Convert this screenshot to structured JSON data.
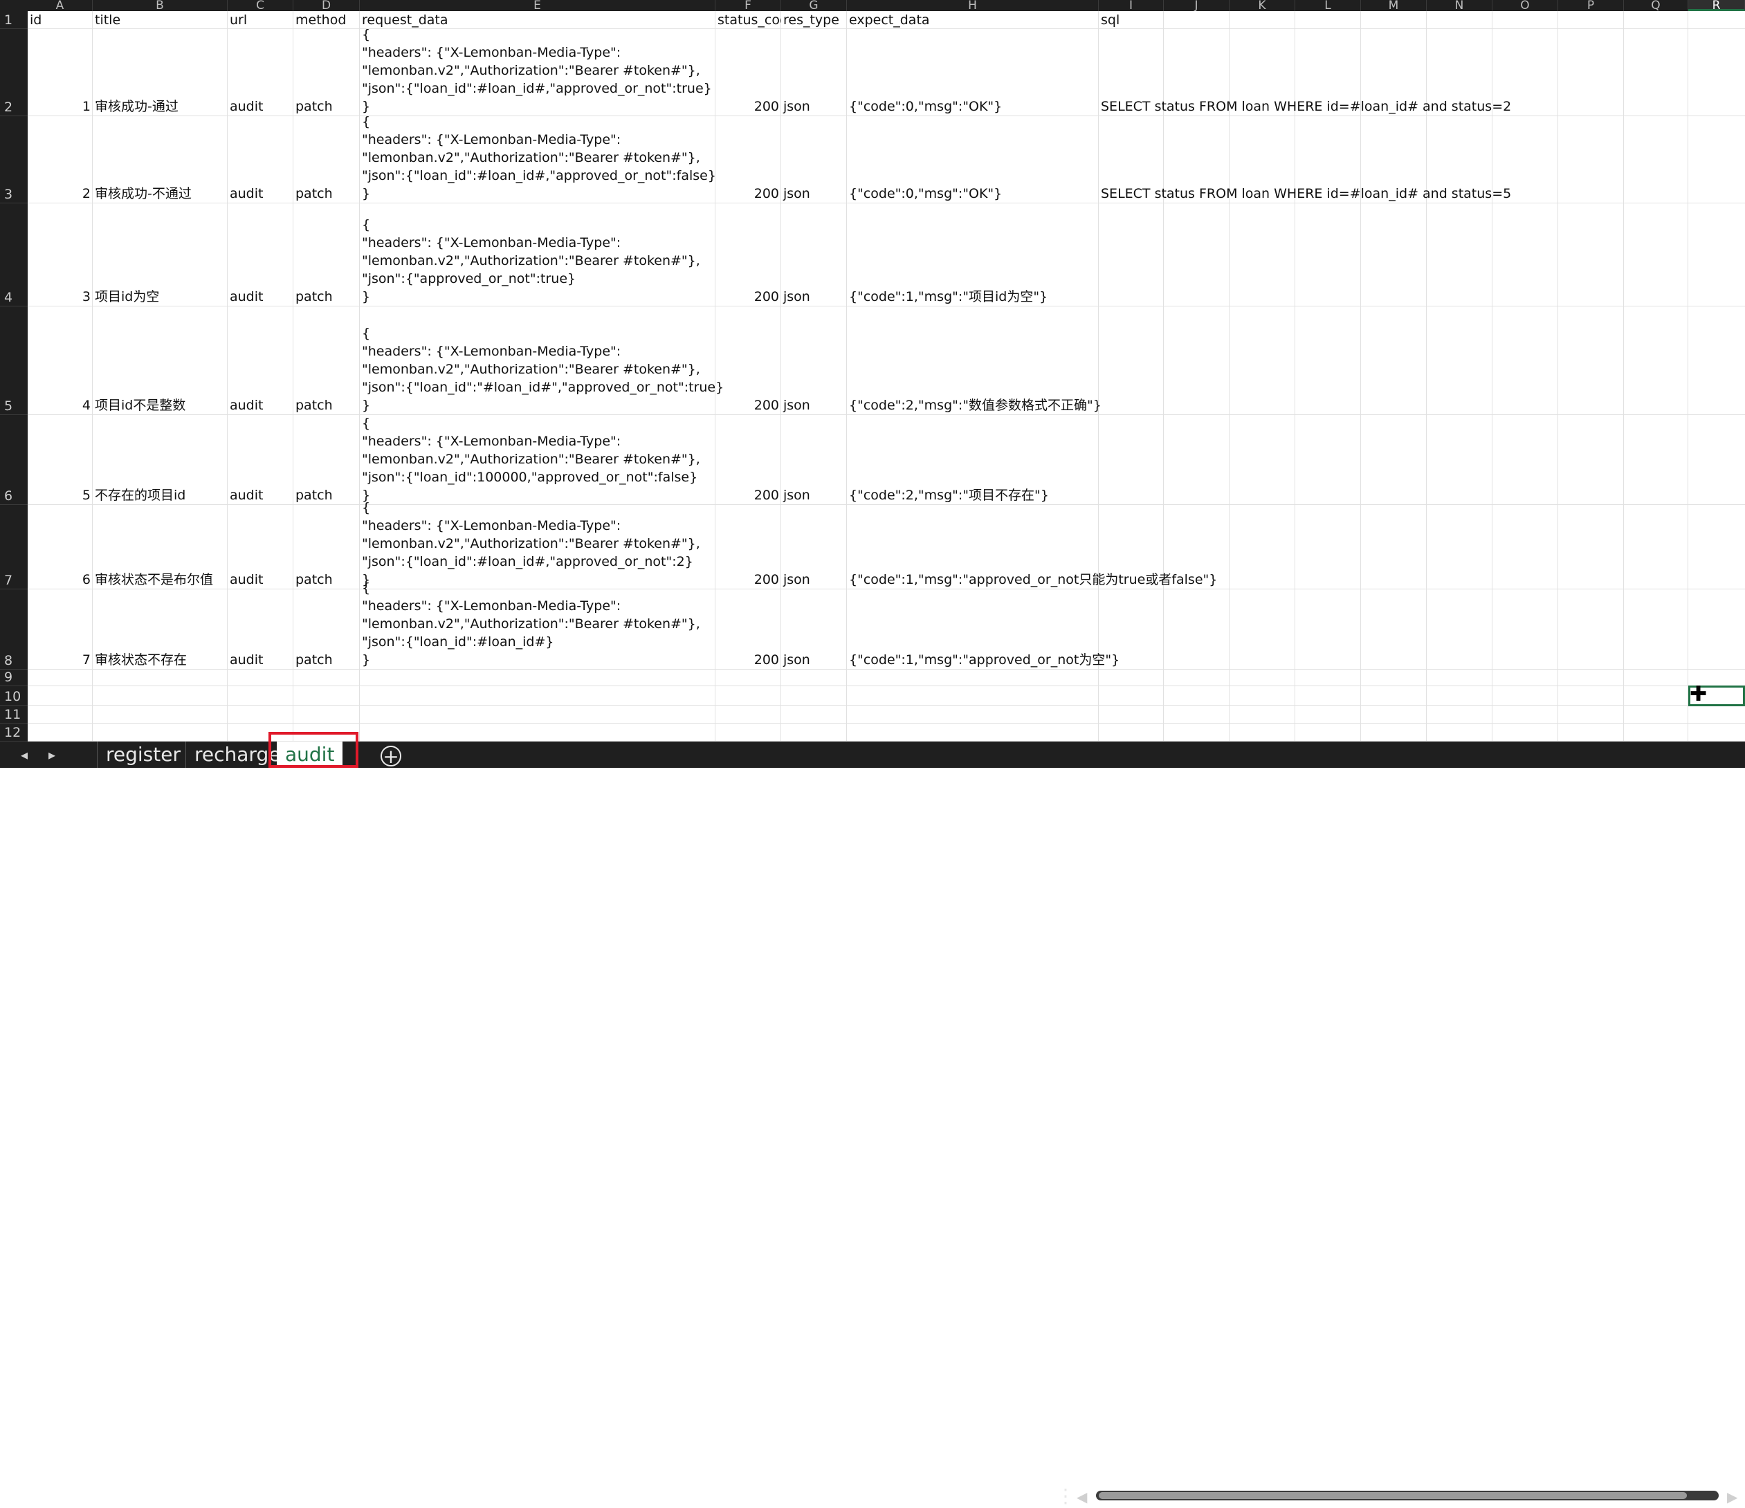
{
  "columns": [
    "A",
    "B",
    "C",
    "D",
    "E",
    "F",
    "G",
    "H",
    "I",
    "J",
    "K",
    "L",
    "M",
    "N",
    "O",
    "P",
    "Q",
    "R"
  ],
  "row_numbers": [
    "1",
    "2",
    "3",
    "4",
    "5",
    "6",
    "7",
    "8",
    "9",
    "10",
    "11",
    "12"
  ],
  "headers": [
    "id",
    "title",
    "url",
    "method",
    "request_data",
    "status_code",
    "res_type",
    "expect_data",
    "sql"
  ],
  "rows": [
    {
      "id": "1",
      "title": "审核成功-通过",
      "url": "audit",
      "method": "patch",
      "request_data": "{\n\"headers\": {\"X-Lemonban-Media-Type\":\n\"lemonban.v2\",\"Authorization\":\"Bearer #token#\"},\n\"json\":{\"loan_id\":#loan_id#,\"approved_or_not\":true}\n}",
      "status_code": "200",
      "res_type": "json",
      "expect_data": "{\"code\":0,\"msg\":\"OK\"}",
      "sql": "SELECT status FROM loan WHERE id=#loan_id# and status=2"
    },
    {
      "id": "2",
      "title": "审核成功-不通过",
      "url": "audit",
      "method": "patch",
      "request_data": "{\n\"headers\": {\"X-Lemonban-Media-Type\":\n\"lemonban.v2\",\"Authorization\":\"Bearer #token#\"},\n\"json\":{\"loan_id\":#loan_id#,\"approved_or_not\":false}\n}",
      "status_code": "200",
      "res_type": "json",
      "expect_data": "{\"code\":0,\"msg\":\"OK\"}",
      "sql": "SELECT status FROM loan WHERE id=#loan_id# and status=5"
    },
    {
      "id": "3",
      "title": "项目id为空",
      "url": "audit",
      "method": "patch",
      "request_data": "{\n\"headers\": {\"X-Lemonban-Media-Type\":\n\"lemonban.v2\",\"Authorization\":\"Bearer #token#\"},\n\"json\":{\"approved_or_not\":true}\n}",
      "status_code": "200",
      "res_type": "json",
      "expect_data": "{\"code\":1,\"msg\":\"项目id为空\"}",
      "sql": ""
    },
    {
      "id": "4",
      "title": "项目id不是整数",
      "url": "audit",
      "method": "patch",
      "request_data": "{\n\"headers\": {\"X-Lemonban-Media-Type\":\n\"lemonban.v2\",\"Authorization\":\"Bearer #token#\"},\n\"json\":{\"loan_id\":\"#loan_id#\",\"approved_or_not\":true}\n}",
      "status_code": "200",
      "res_type": "json",
      "expect_data": "{\"code\":2,\"msg\":\"数值参数格式不正确\"}",
      "sql": ""
    },
    {
      "id": "5",
      "title": "不存在的项目id",
      "url": "audit",
      "method": "patch",
      "request_data": "{\n\"headers\": {\"X-Lemonban-Media-Type\":\n\"lemonban.v2\",\"Authorization\":\"Bearer #token#\"},\n\"json\":{\"loan_id\":100000,\"approved_or_not\":false}\n}",
      "status_code": "200",
      "res_type": "json",
      "expect_data": "{\"code\":2,\"msg\":\"项目不存在\"}",
      "sql": ""
    },
    {
      "id": "6",
      "title": "审核状态不是布尔值",
      "url": "audit",
      "method": "patch",
      "request_data": "{\n\"headers\": {\"X-Lemonban-Media-Type\":\n\"lemonban.v2\",\"Authorization\":\"Bearer #token#\"},\n\"json\":{\"loan_id\":#loan_id#,\"approved_or_not\":2}\n}",
      "status_code": "200",
      "res_type": "json",
      "expect_data": "{\"code\":1,\"msg\":\"approved_or_not只能为true或者false\"}",
      "sql": ""
    },
    {
      "id": "7",
      "title": "审核状态不存在",
      "url": "audit",
      "method": "patch",
      "request_data": "{\n\"headers\": {\"X-Lemonban-Media-Type\":\n\"lemonban.v2\",\"Authorization\":\"Bearer #token#\"},\n\"json\":{\"loan_id\":#loan_id#}\n}",
      "status_code": "200",
      "res_type": "json",
      "expect_data": "{\"code\":1,\"msg\":\"approved_or_not为空\"}",
      "sql": ""
    }
  ],
  "sheet_tabs": [
    "register",
    "recharge",
    "audit"
  ],
  "active_sheet": "audit",
  "icons": {
    "prev": "chevron-left-icon",
    "next": "chevron-right-icon",
    "add_sheet": "plus-circle-icon",
    "more": "vertical-dots-icon"
  },
  "colors": {
    "accent": "#217346",
    "highlight_box": "#e0192a",
    "header_bg": "#1f1f1f"
  }
}
